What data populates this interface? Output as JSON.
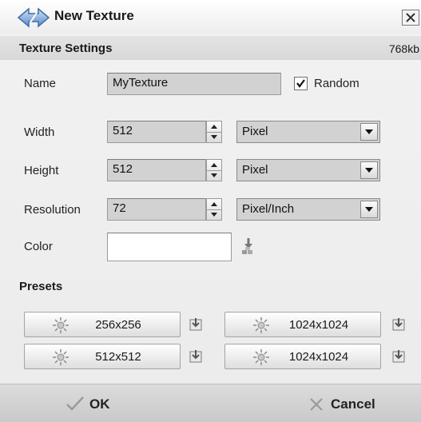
{
  "window": {
    "title": "New Texture",
    "icon": "double-arrow-logo-icon",
    "close_icon": "close-icon"
  },
  "texture_settings": {
    "title": "Texture Settings",
    "size": "768kb"
  },
  "form": {
    "name": {
      "label": "Name",
      "value": "MyTexture"
    },
    "random": {
      "label": "Random",
      "checked": true
    },
    "width": {
      "label": "Width",
      "value": "512",
      "unit": "Pixel"
    },
    "height": {
      "label": "Height",
      "value": "512",
      "unit": "Pixel"
    },
    "resolution": {
      "label": "Resolution",
      "value": "72",
      "unit": "Pixel/Inch"
    },
    "color": {
      "label": "Color",
      "value": "#ffffff",
      "picker_icon": "color-picker-icon"
    }
  },
  "presets": {
    "title": "Presets",
    "items": [
      {
        "label": "256x256",
        "icon": "sun-icon",
        "save_icon": "save-preset-icon"
      },
      {
        "label": "1024x1024",
        "icon": "sun-icon",
        "save_icon": "save-preset-icon"
      },
      {
        "label": "512x512",
        "icon": "sun-icon",
        "save_icon": "save-preset-icon"
      },
      {
        "label": "1024x1024",
        "icon": "sun-icon",
        "save_icon": "save-preset-icon"
      }
    ]
  },
  "actions": {
    "ok": "OK",
    "cancel": "Cancel"
  },
  "colors": {
    "field_bg": "#d2d2d2",
    "panel_bg": "#ececec"
  }
}
